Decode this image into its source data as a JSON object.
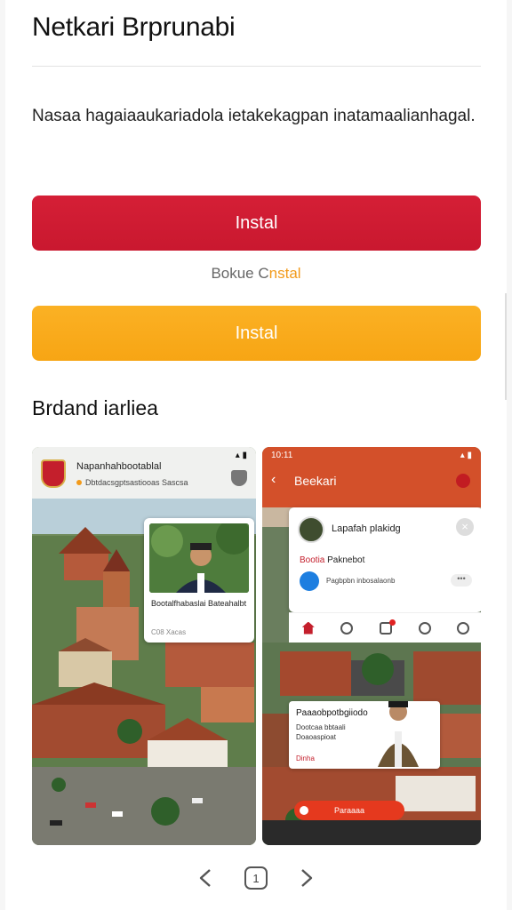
{
  "header": {
    "title": "Netkari Brprunabi"
  },
  "description": "Nasaa hagaiaaukariadola ietakekagpan inatamaalianhagal.",
  "buttons": {
    "primary_label": "Instal",
    "secondary_label": "Instal"
  },
  "alt_link": {
    "prefix": "Bokue C",
    "accent": "nstal"
  },
  "section": {
    "title": "Brdand iarliea"
  },
  "screenshot_left": {
    "app_name": "Napanhahbootablal",
    "subtitle": "Dbtdacsgptsastiooas Sascsa",
    "news_title": "Bootalfhabaslai Bateahalbt",
    "news_meta": "C08 Xacas"
  },
  "screenshot_right": {
    "status_time": "10:11",
    "app_name": "Beekari",
    "profile_name": "Lapafah plakidg",
    "tag_prefix": "Bootia",
    "tag_rest": "Paknebot",
    "line": "Pagbpbn inbosalaonb",
    "more": "•••",
    "feed_title": "Paaaobpotbgiiodo",
    "feed_sub": "Dootcaa bbtaali Doaoaspioat",
    "feed_tag": "Dinha",
    "cta_label": "Paraaaa"
  },
  "pager": {
    "current": "1"
  },
  "colors": {
    "primary": "#d51f36",
    "secondary": "#f7a514",
    "accent": "#d3502a"
  }
}
